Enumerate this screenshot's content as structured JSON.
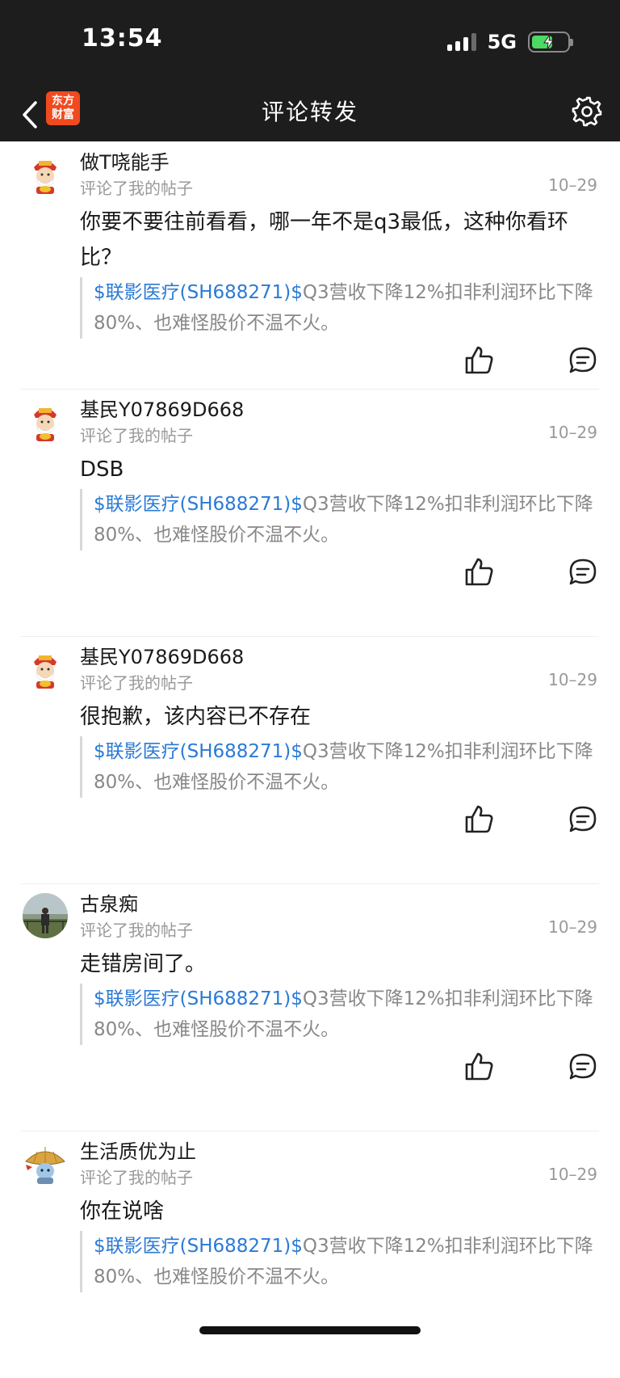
{
  "status": {
    "time": "13:54",
    "network": "5G",
    "battery_level": 0.6
  },
  "nav": {
    "title": "评论转发",
    "logo_line1": "东方",
    "logo_line2": "财富"
  },
  "items": [
    {
      "username": "做T哓能手",
      "meta": "评论了我的帖子",
      "date": "10–29",
      "comment": "你要不要往前看看，哪一年不是q3最低，这种你看环比？",
      "quote_stock": "$联影医疗(SH688271)$",
      "quote_text": "Q3营收下降12%扣非利润环比下降80%、也难怪股价不温不火。",
      "avatar": "cartoon-figure-avatar"
    },
    {
      "username": "基民Y07869D668",
      "meta": "评论了我的帖子",
      "date": "10–29",
      "comment": "DSB",
      "quote_stock": "$联影医疗(SH688271)$",
      "quote_text": "Q3营收下降12%扣非利润环比下降80%、也难怪股价不温不火。",
      "avatar": "cartoon-figure-avatar"
    },
    {
      "username": "基民Y07869D668",
      "meta": "评论了我的帖子",
      "date": "10–29",
      "comment": "很抱歉，该内容已不存在",
      "quote_stock": "$联影医疗(SH688271)$",
      "quote_text": "Q3营收下降12%扣非利润环比下降80%、也难怪股价不温不火。",
      "avatar": "cartoon-figure-avatar"
    },
    {
      "username": "古泉痴",
      "meta": "评论了我的帖子",
      "date": "10–29",
      "comment": "走错房间了。",
      "quote_stock": "$联影医疗(SH688271)$",
      "quote_text": "Q3营收下降12%扣非利润环比下降80%、也难怪股价不温不火。",
      "avatar": "photo-avatar"
    },
    {
      "username": "生活质优为止",
      "meta": "评论了我的帖子",
      "date": "10–29",
      "comment": "你在说啥",
      "quote_stock": "$联影医疗(SH688271)$",
      "quote_text": "Q3营收下降12%扣非利润环比下降80%、也难怪股价不温不火。",
      "avatar": "straw-hat-avatar"
    }
  ],
  "icons": {
    "like": "thumbs-up-icon",
    "reply": "comment-icon",
    "settings": "gear-icon",
    "back": "chevron-left-icon"
  }
}
